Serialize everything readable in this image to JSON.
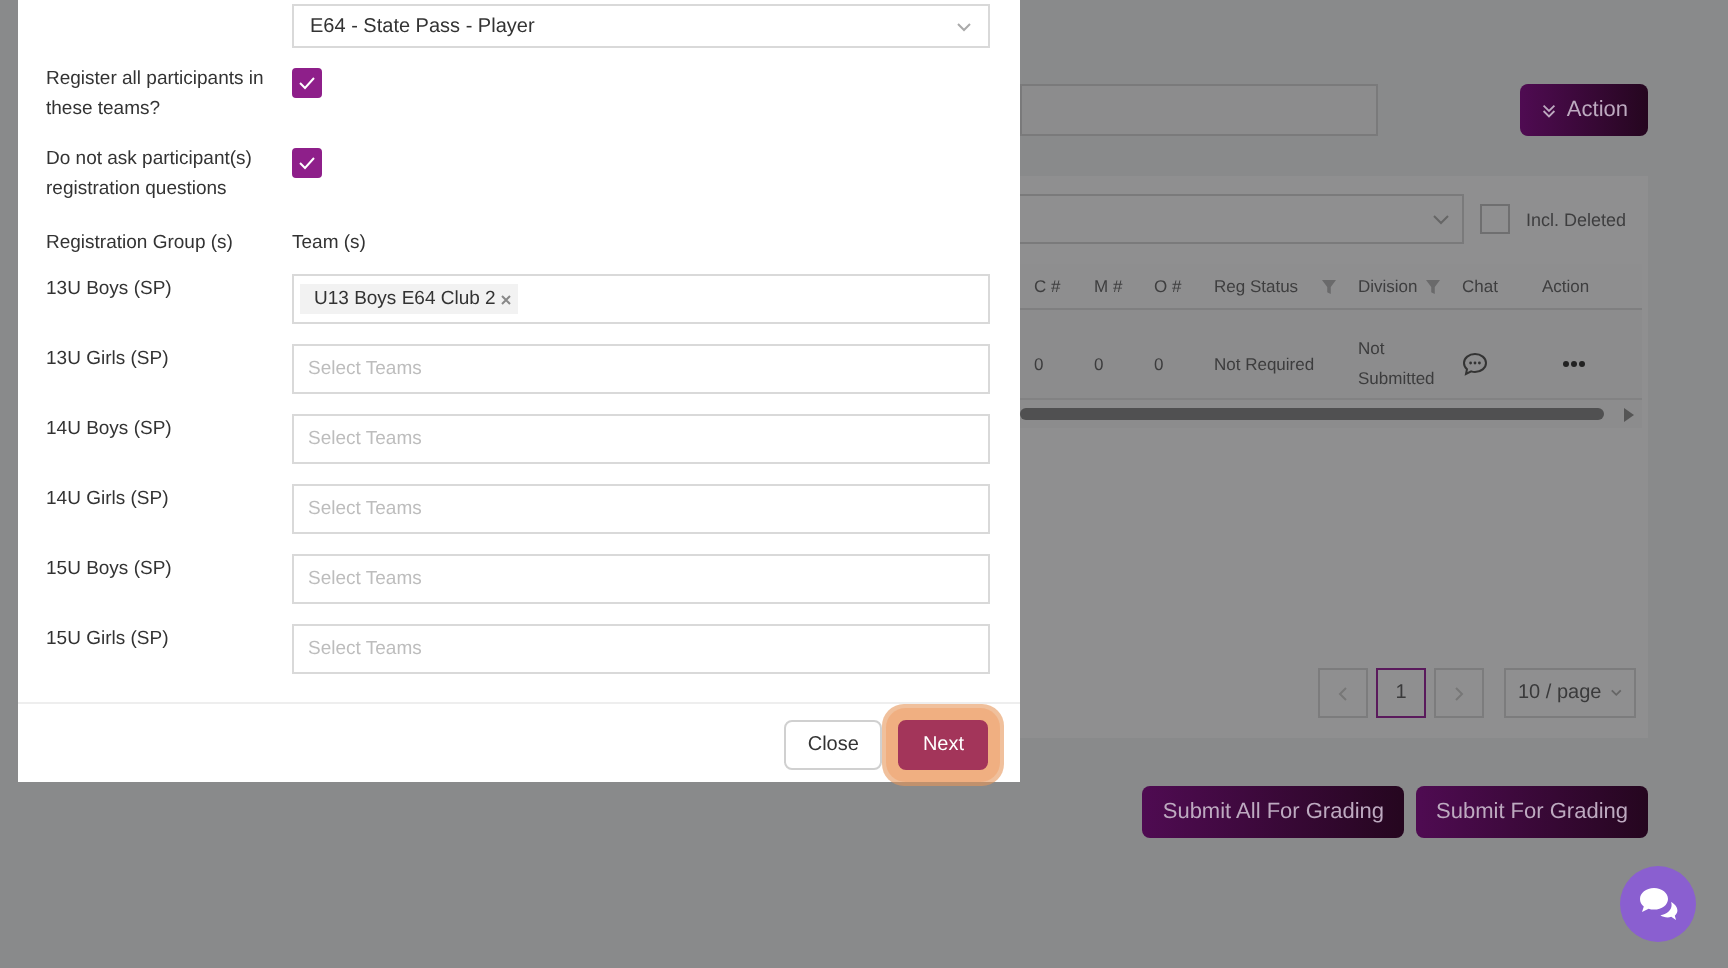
{
  "page": {
    "action_button": "Action",
    "incl_deleted": {
      "label": "Incl. Deleted",
      "checked": false
    },
    "table": {
      "columns": [
        {
          "label": "C #",
          "filter": false
        },
        {
          "label": "M #",
          "filter": false
        },
        {
          "label": "O #",
          "filter": false
        },
        {
          "label": "Reg Status",
          "filter": true
        },
        {
          "label": "Division",
          "filter": true
        },
        {
          "label": "Chat",
          "filter": false
        },
        {
          "label": "Action",
          "filter": false
        }
      ],
      "rows": [
        {
          "cells": [
            "0",
            "0",
            "0",
            "Not Required",
            "Not Submitted"
          ]
        }
      ]
    },
    "pagination": {
      "pages": [
        {
          "label": "1",
          "selected": true
        }
      ],
      "page_size": "10 / page"
    },
    "buttons": [
      "Submit All For Grading",
      "Submit For Grading"
    ]
  },
  "modal": {
    "select_value": "E64 - State Pass - Player",
    "options": [
      {
        "label": "Register all participants in these teams?",
        "checked": true
      },
      {
        "label": "Do not ask participant(s) registration questions",
        "checked": true
      }
    ],
    "columns": [
      "Registration Group (s)",
      "Team (s)"
    ],
    "groups": [
      {
        "name": "13U Boys (SP)",
        "teams": [
          "U13 Boys E64 Club 2"
        ]
      },
      {
        "name": "13U Girls (SP)",
        "placeholder": "Select Teams"
      },
      {
        "name": "14U Boys (SP)",
        "placeholder": "Select Teams"
      },
      {
        "name": "14U Girls (SP)",
        "placeholder": "Select Teams"
      },
      {
        "name": "15U Boys (SP)",
        "placeholder": "Select Teams"
      },
      {
        "name": "15U Girls (SP)",
        "placeholder": "Select Teams"
      }
    ],
    "buttons": [
      {
        "label": "Close",
        "kind": "secondary",
        "highlighted": false
      },
      {
        "label": "Next",
        "kind": "primary",
        "highlighted": true
      }
    ]
  }
}
